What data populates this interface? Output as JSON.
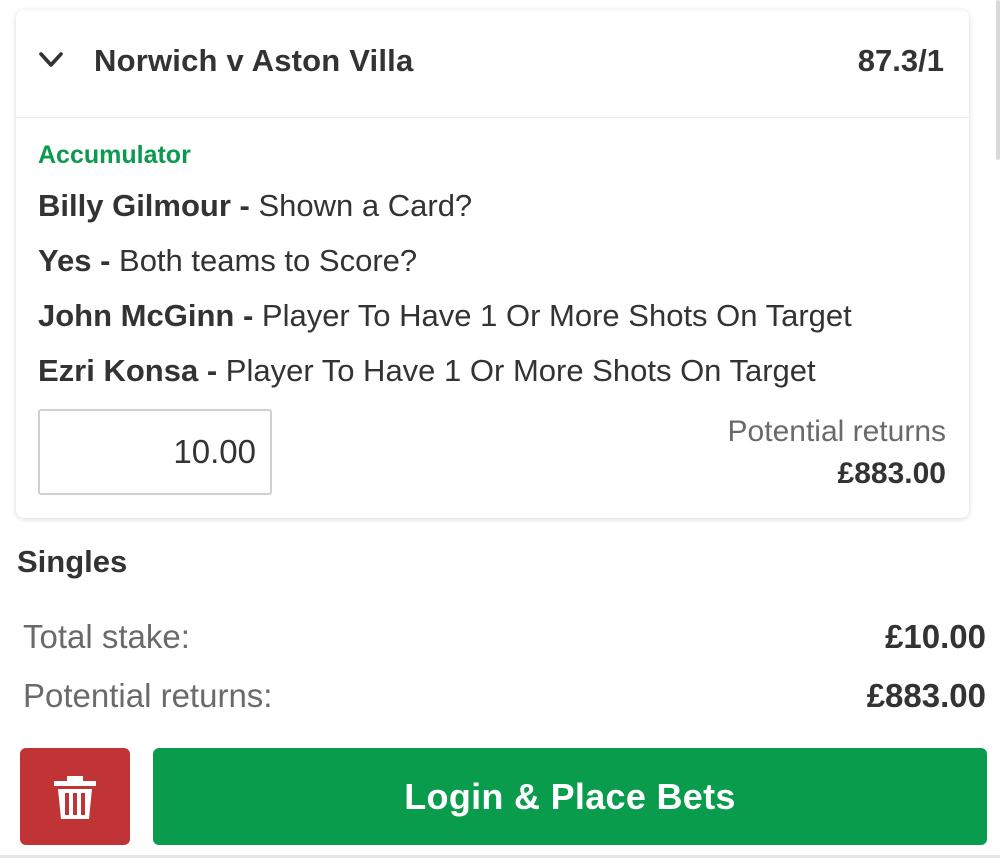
{
  "bet_card": {
    "event_title": "Norwich v Aston Villa",
    "odds": "87.3/1",
    "collapse_icon": "chevron-down-icon",
    "bet_type": "Accumulator",
    "selections": [
      {
        "name": "Billy Gilmour",
        "dash": " - ",
        "market": "Shown a Card?"
      },
      {
        "name": "Yes",
        "dash": " - ",
        "market": "Both teams to Score?"
      },
      {
        "name": "John McGinn",
        "dash": " - ",
        "market": "Player To Have 1 Or More Shots On Target"
      },
      {
        "name": "Ezri Konsa",
        "dash": " - ",
        "market": "Player To Have 1 Or More Shots On Target"
      }
    ],
    "stake_value": "10.00",
    "potential_returns_label": "Potential returns",
    "potential_returns_value": "£883.00"
  },
  "singles": {
    "title": "Singles"
  },
  "summary": {
    "total_stake_label": "Total stake:",
    "total_stake_value": "£10.00",
    "potential_returns_label": "Potential returns:",
    "potential_returns_value": "£883.00"
  },
  "actions": {
    "delete_icon": "trash-icon",
    "place_bets_label": "Login & Place Bets"
  },
  "colors": {
    "brand_green": "#0a9c4d",
    "accumulator_green": "#0b9a4e",
    "delete_red": "#c13436"
  }
}
